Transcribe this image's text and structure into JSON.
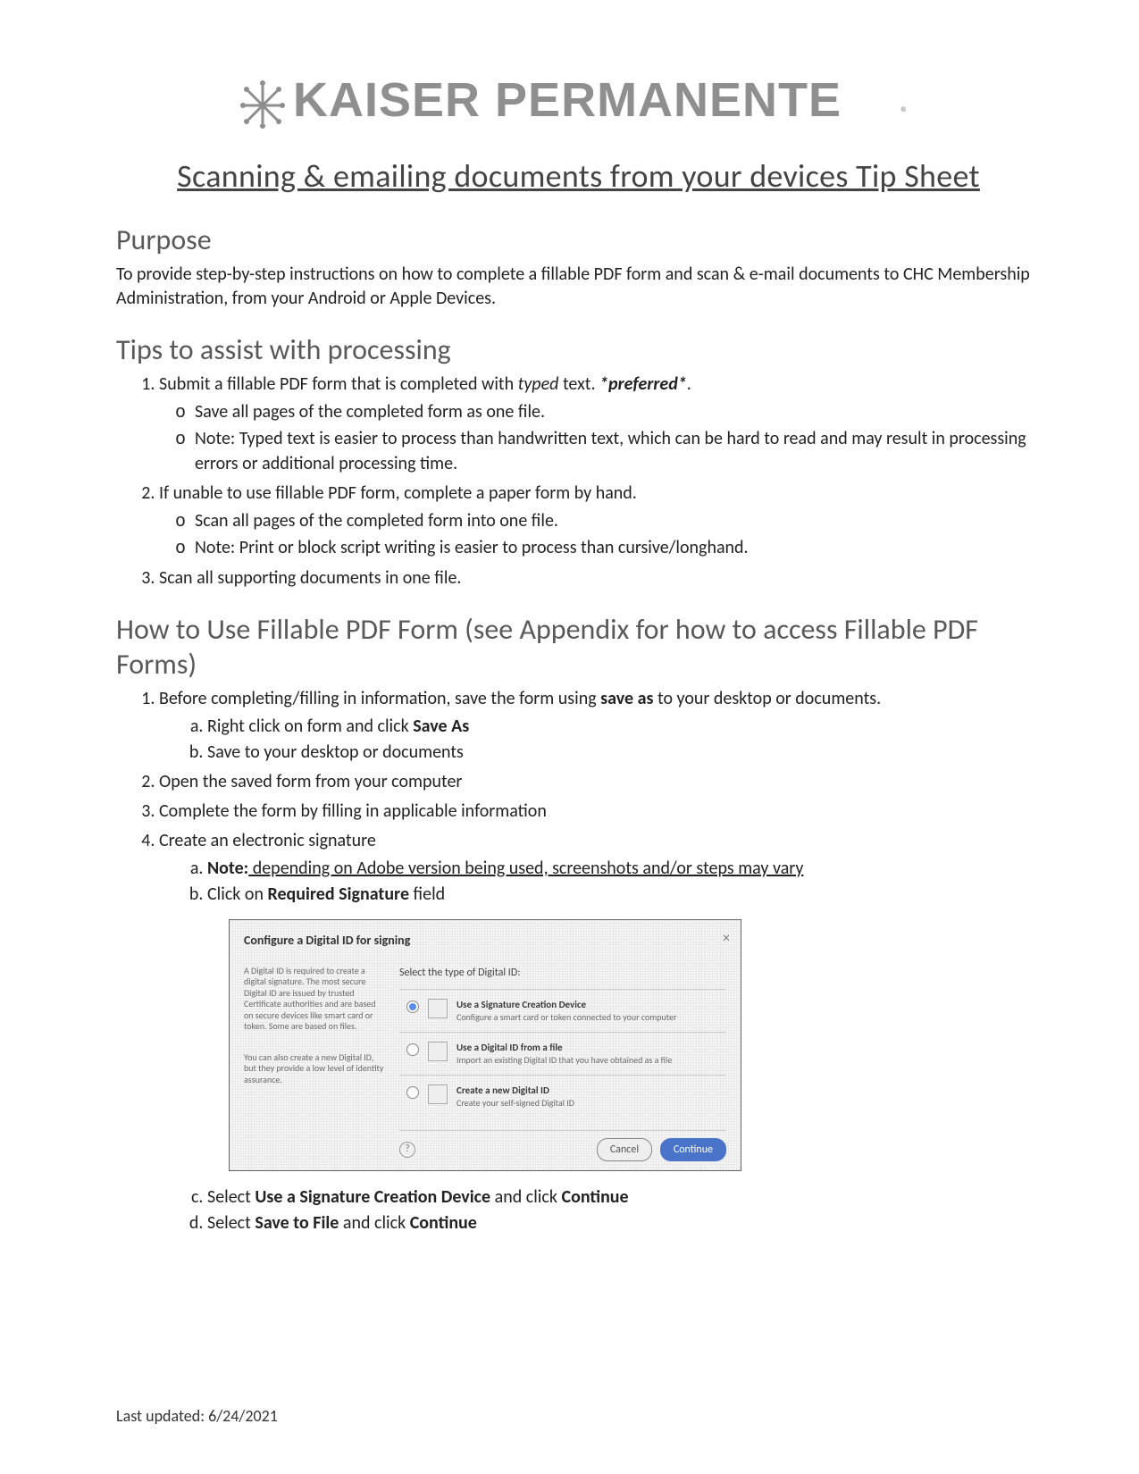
{
  "logo_text": "KAISER PERMANENTE",
  "logo_mark": "®",
  "doc_title": "Scanning & emailing documents from your devices Tip Sheet",
  "purpose": {
    "heading": "Purpose",
    "body": "To provide step-by-step instructions on how to complete a fillable PDF form and scan & e-mail documents to CHC Membership Administration, from your Android or Apple Devices."
  },
  "tips": {
    "heading": "Tips to assist with processing",
    "items": {
      "i1_pre": "Submit a fillable PDF form that is completed with ",
      "i1_typed": "typed",
      "i1_mid": " text. ",
      "i1_pref": "*preferred*",
      "i1_end": ".",
      "i1a": "Save all pages of the completed form as one file.",
      "i1b": "Note: Typed text is easier to process than handwritten text, which can be hard to read and may result in processing errors or additional processing time.",
      "i2": "If unable to use fillable PDF form, complete a paper form by hand.",
      "i2a": "Scan all pages of the completed form into one file.",
      "i2b": "Note: Print or block script writing is easier to process than cursive/longhand.",
      "i3": "Scan all supporting documents in one file."
    }
  },
  "howto": {
    "heading": "How to Use Fillable PDF Form (see Appendix for how to access Fillable PDF Forms)",
    "s1_pre": "Before completing/filling in information, save the form using ",
    "s1_bold": "save as",
    "s1_post": " to your desktop or documents.",
    "s1a_pre": "Right click on form and click ",
    "s1a_bold": "Save As",
    "s1b": "Save to your desktop or documents",
    "s2": "Open the saved form from your computer",
    "s3": "Complete the form by filling in applicable information",
    "s4": "Create an electronic signature",
    "s4a_bold": "Note:",
    "s4a_u": " depending on Adobe version being used, screenshots and/or steps may vary",
    "s4b_pre": "Click on ",
    "s4b_bold": "Required Signature",
    "s4b_post": " field",
    "s4c_pre": "Select ",
    "s4c_bold": "Use a Signature Creation Device",
    "s4c_mid": " and click ",
    "s4c_bold2": "Continue",
    "s4d_pre": "Select ",
    "s4d_bold": "Save to File",
    "s4d_mid": " and click ",
    "s4d_bold2": "Continue"
  },
  "dialog": {
    "title": "Configure a Digital ID for signing",
    "lead": "Select the type of Digital ID:",
    "left1": "A Digital ID is required to create a digital signature. The most secure Digital ID are issued by trusted Certificate authorities and are based on secure devices like smart card or token. Some are based on files.",
    "left2": "You can also create a new Digital ID, but they provide a low level of identity assurance.",
    "opt1_t": "Use a Signature Creation Device",
    "opt1_d": "Configure a smart card or token connected to your computer",
    "opt2_t": "Use a Digital ID from a file",
    "opt2_d": "Import an existing Digital ID that you have obtained as a file",
    "opt3_t": "Create a new Digital ID",
    "opt3_d": "Create your self-signed Digital ID",
    "btn_cancel": "Cancel",
    "btn_continue": "Continue"
  },
  "footer": "Last updated: 6/24/2021"
}
